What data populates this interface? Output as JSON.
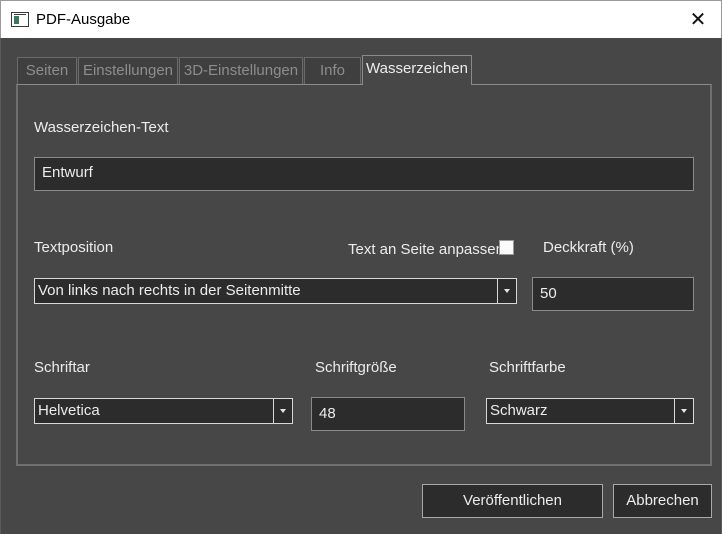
{
  "window": {
    "title": "PDF-Ausgabe",
    "close_glyph": "✕"
  },
  "tabs": [
    {
      "label": "Seiten",
      "active": false
    },
    {
      "label": "Einstellungen",
      "active": false
    },
    {
      "label": "3D-Einstellungen",
      "active": false
    },
    {
      "label": "Info",
      "active": false
    },
    {
      "label": "Wasserzeichen",
      "active": true
    }
  ],
  "watermark": {
    "text_label": "Wasserzeichen-Text",
    "text_value": "Entwurf",
    "position_label": "Textposition",
    "position_value": "Von links nach rechts in der Seitenmitte",
    "fit_label": "Text an Seite anpassen",
    "fit_checked": false,
    "opacity_label": "Deckkraft (%)",
    "opacity_value": "50",
    "font_label": "Schriftar",
    "font_value": "Helvetica",
    "size_label": "Schriftgröße",
    "size_value": "48",
    "color_label": "Schriftfarbe",
    "color_value": "Schwarz"
  },
  "buttons": {
    "publish": "Veröffentlichen",
    "cancel": "Abbrechen"
  },
  "icons": {
    "app": "app-window-icon",
    "close": "close-icon",
    "dropdown": "chevron-down-icon"
  }
}
